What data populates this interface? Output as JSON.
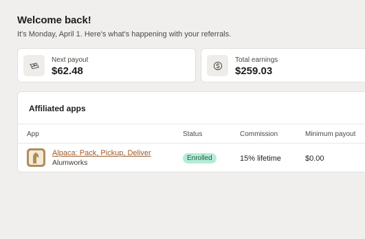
{
  "header": {
    "title": "Welcome back!",
    "subtitle": "It's Monday, April 1. Here's what's happening with your referrals."
  },
  "stats": {
    "payout": {
      "label": "Next payout",
      "value": "$62.48",
      "icon": "cash-icon"
    },
    "earnings": {
      "label": "Total earnings",
      "value": "$259.03",
      "icon": "dollar-coin-icon"
    }
  },
  "affiliates": {
    "title": "Affiliated apps",
    "columns": {
      "app": "App",
      "status": "Status",
      "commission": "Commission",
      "minimum": "Minimum payout"
    },
    "rows": [
      {
        "app_name": "Alpaca: Pack, Pickup, Deliver",
        "company": "Alumworks",
        "status": "Enrolled",
        "commission": "15% lifetime",
        "minimum": "$0.00",
        "icon": "alpaca-app-icon"
      }
    ]
  },
  "colors": {
    "background": "#f1efed",
    "link": "#9c5a2a",
    "badge_bg": "#b4ecd6",
    "badge_text": "#1d5c44"
  }
}
